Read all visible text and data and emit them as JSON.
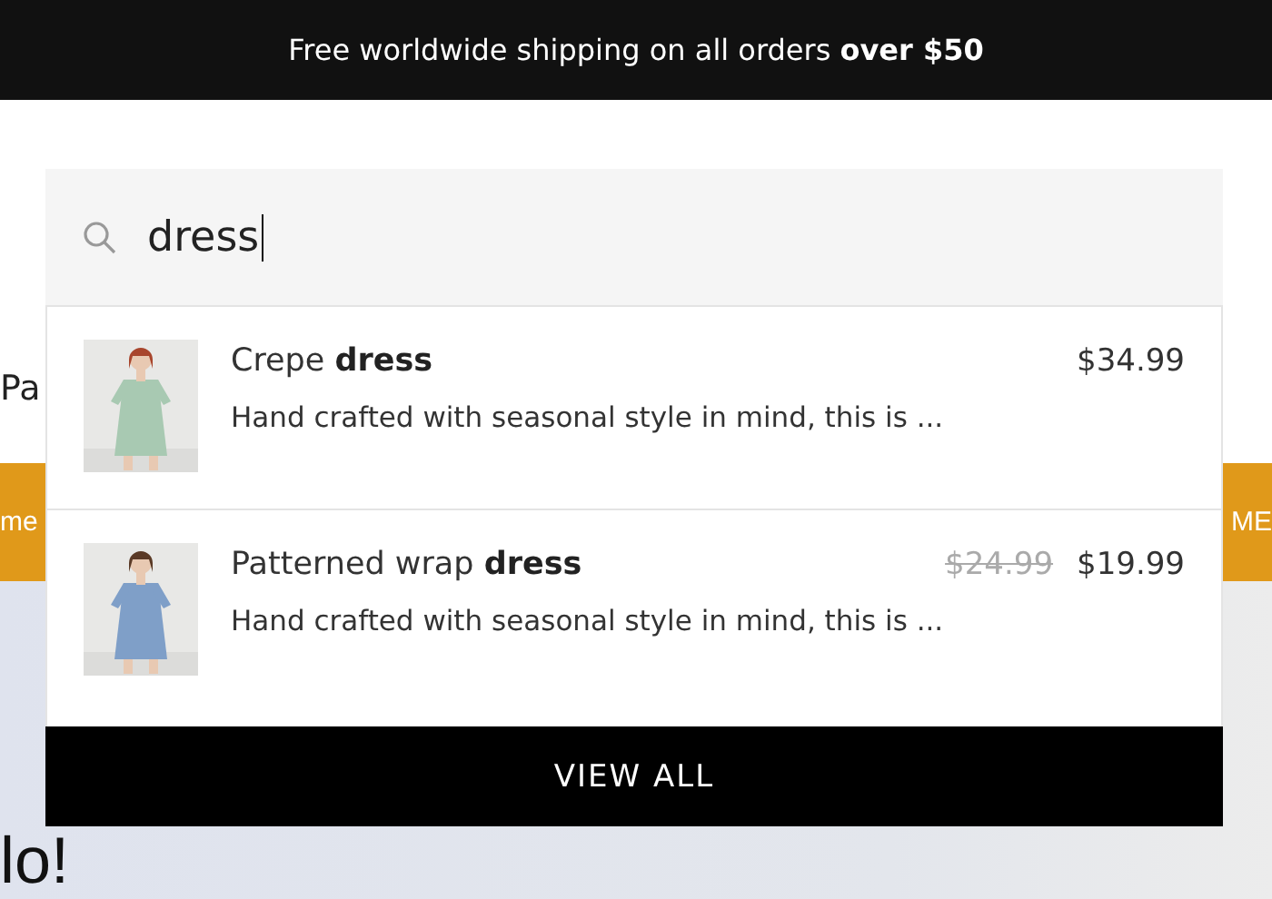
{
  "announcement": "Free worldwide shipping on all orders **over $50**",
  "background": {
    "left_text": "Pa",
    "banner_left": "me",
    "banner_right": "ME",
    "hero_text": "lo!"
  },
  "search": {
    "value": "dress"
  },
  "results": [
    {
      "title": "Crepe **dress**",
      "description": "Hand crafted with seasonal style in mind, this is ...",
      "price": "$34.99"
    },
    {
      "title": "Patterned wrap **dress**",
      "description": "Hand crafted with seasonal style in mind, this is ...",
      "original_price": "$24.99",
      "price": "$19.99"
    }
  ],
  "view_all": "VIEW ALL"
}
